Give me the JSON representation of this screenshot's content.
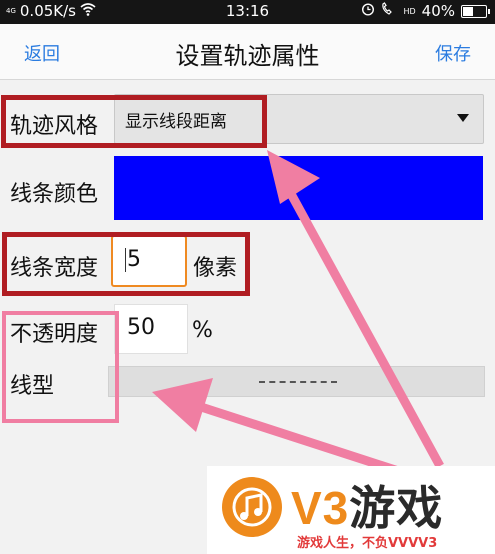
{
  "status_bar": {
    "network_type": "4G",
    "speed": "0.05K/s",
    "time": "13:16",
    "hd_badge": "HD",
    "battery_text": "40%",
    "battery_level": 0.4,
    "icons": [
      "wifi-icon",
      "alarm-icon",
      "call-hd-icon",
      "battery-icon"
    ]
  },
  "header": {
    "back_label": "返回",
    "title": "设置轨迹属性",
    "save_label": "保存"
  },
  "form": {
    "style_label": "轨迹风格",
    "style_value": "显示线段距离",
    "color_label": "线条颜色",
    "color_value": "#0000ff",
    "width_label": "线条宽度",
    "width_value": "5",
    "width_unit": "像素",
    "opacity_label": "不透明度",
    "opacity_value": "50",
    "opacity_unit": "%",
    "linetype_label": "线型"
  },
  "annotations": {
    "box_colors": {
      "red": "#b01d22",
      "pink": "#f07ea2"
    },
    "arrow_color": "#f07ea2"
  },
  "watermark": {
    "name_prefix": "V3",
    "name_suffix": "游戏",
    "slogan": "游戏人生，不负VVVV3",
    "accent": "#ee8a1c"
  }
}
